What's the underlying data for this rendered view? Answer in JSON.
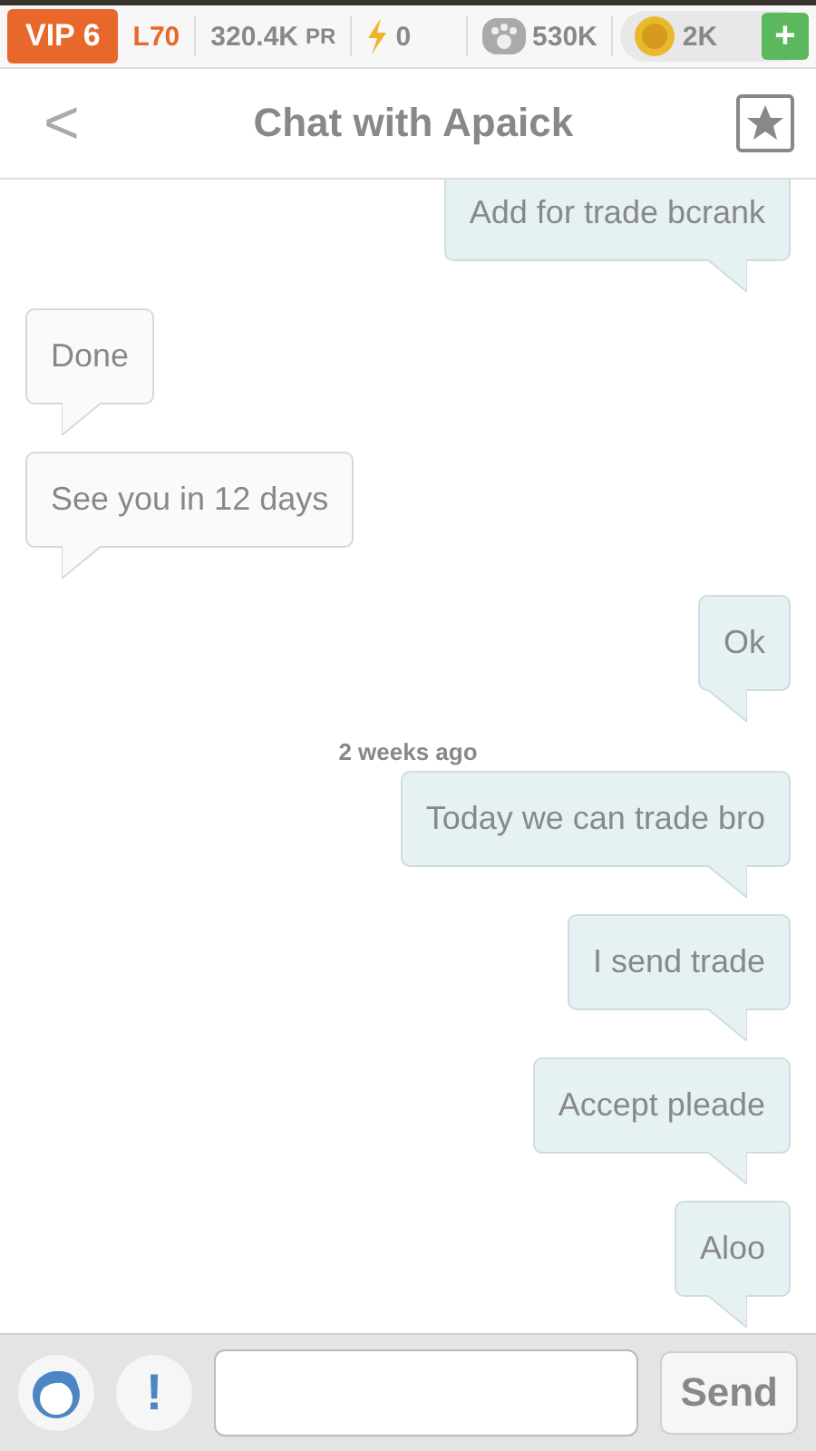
{
  "status_bar": {
    "vip": "VIP 6",
    "level": "L70",
    "power": "320.4K",
    "power_unit": "PR",
    "energy": "0",
    "food": "530K",
    "gold": "2K",
    "add": "+"
  },
  "header": {
    "back": "<",
    "title": "Chat with Apaick"
  },
  "messages": [
    {
      "kind": "outgoing",
      "text": "Add for trade bcrank"
    },
    {
      "kind": "incoming",
      "text": "Done"
    },
    {
      "kind": "incoming",
      "text": "See you in 12 days"
    },
    {
      "kind": "outgoing",
      "text": "Ok"
    },
    {
      "kind": "timestamp",
      "text": "2 weeks ago"
    },
    {
      "kind": "outgoing",
      "text": "Today we can trade bro"
    },
    {
      "kind": "outgoing",
      "text": "I send trade"
    },
    {
      "kind": "outgoing",
      "text": "Accept pleade"
    },
    {
      "kind": "outgoing",
      "text": "Aloo"
    }
  ],
  "composer": {
    "report": "!",
    "send": "Send"
  }
}
